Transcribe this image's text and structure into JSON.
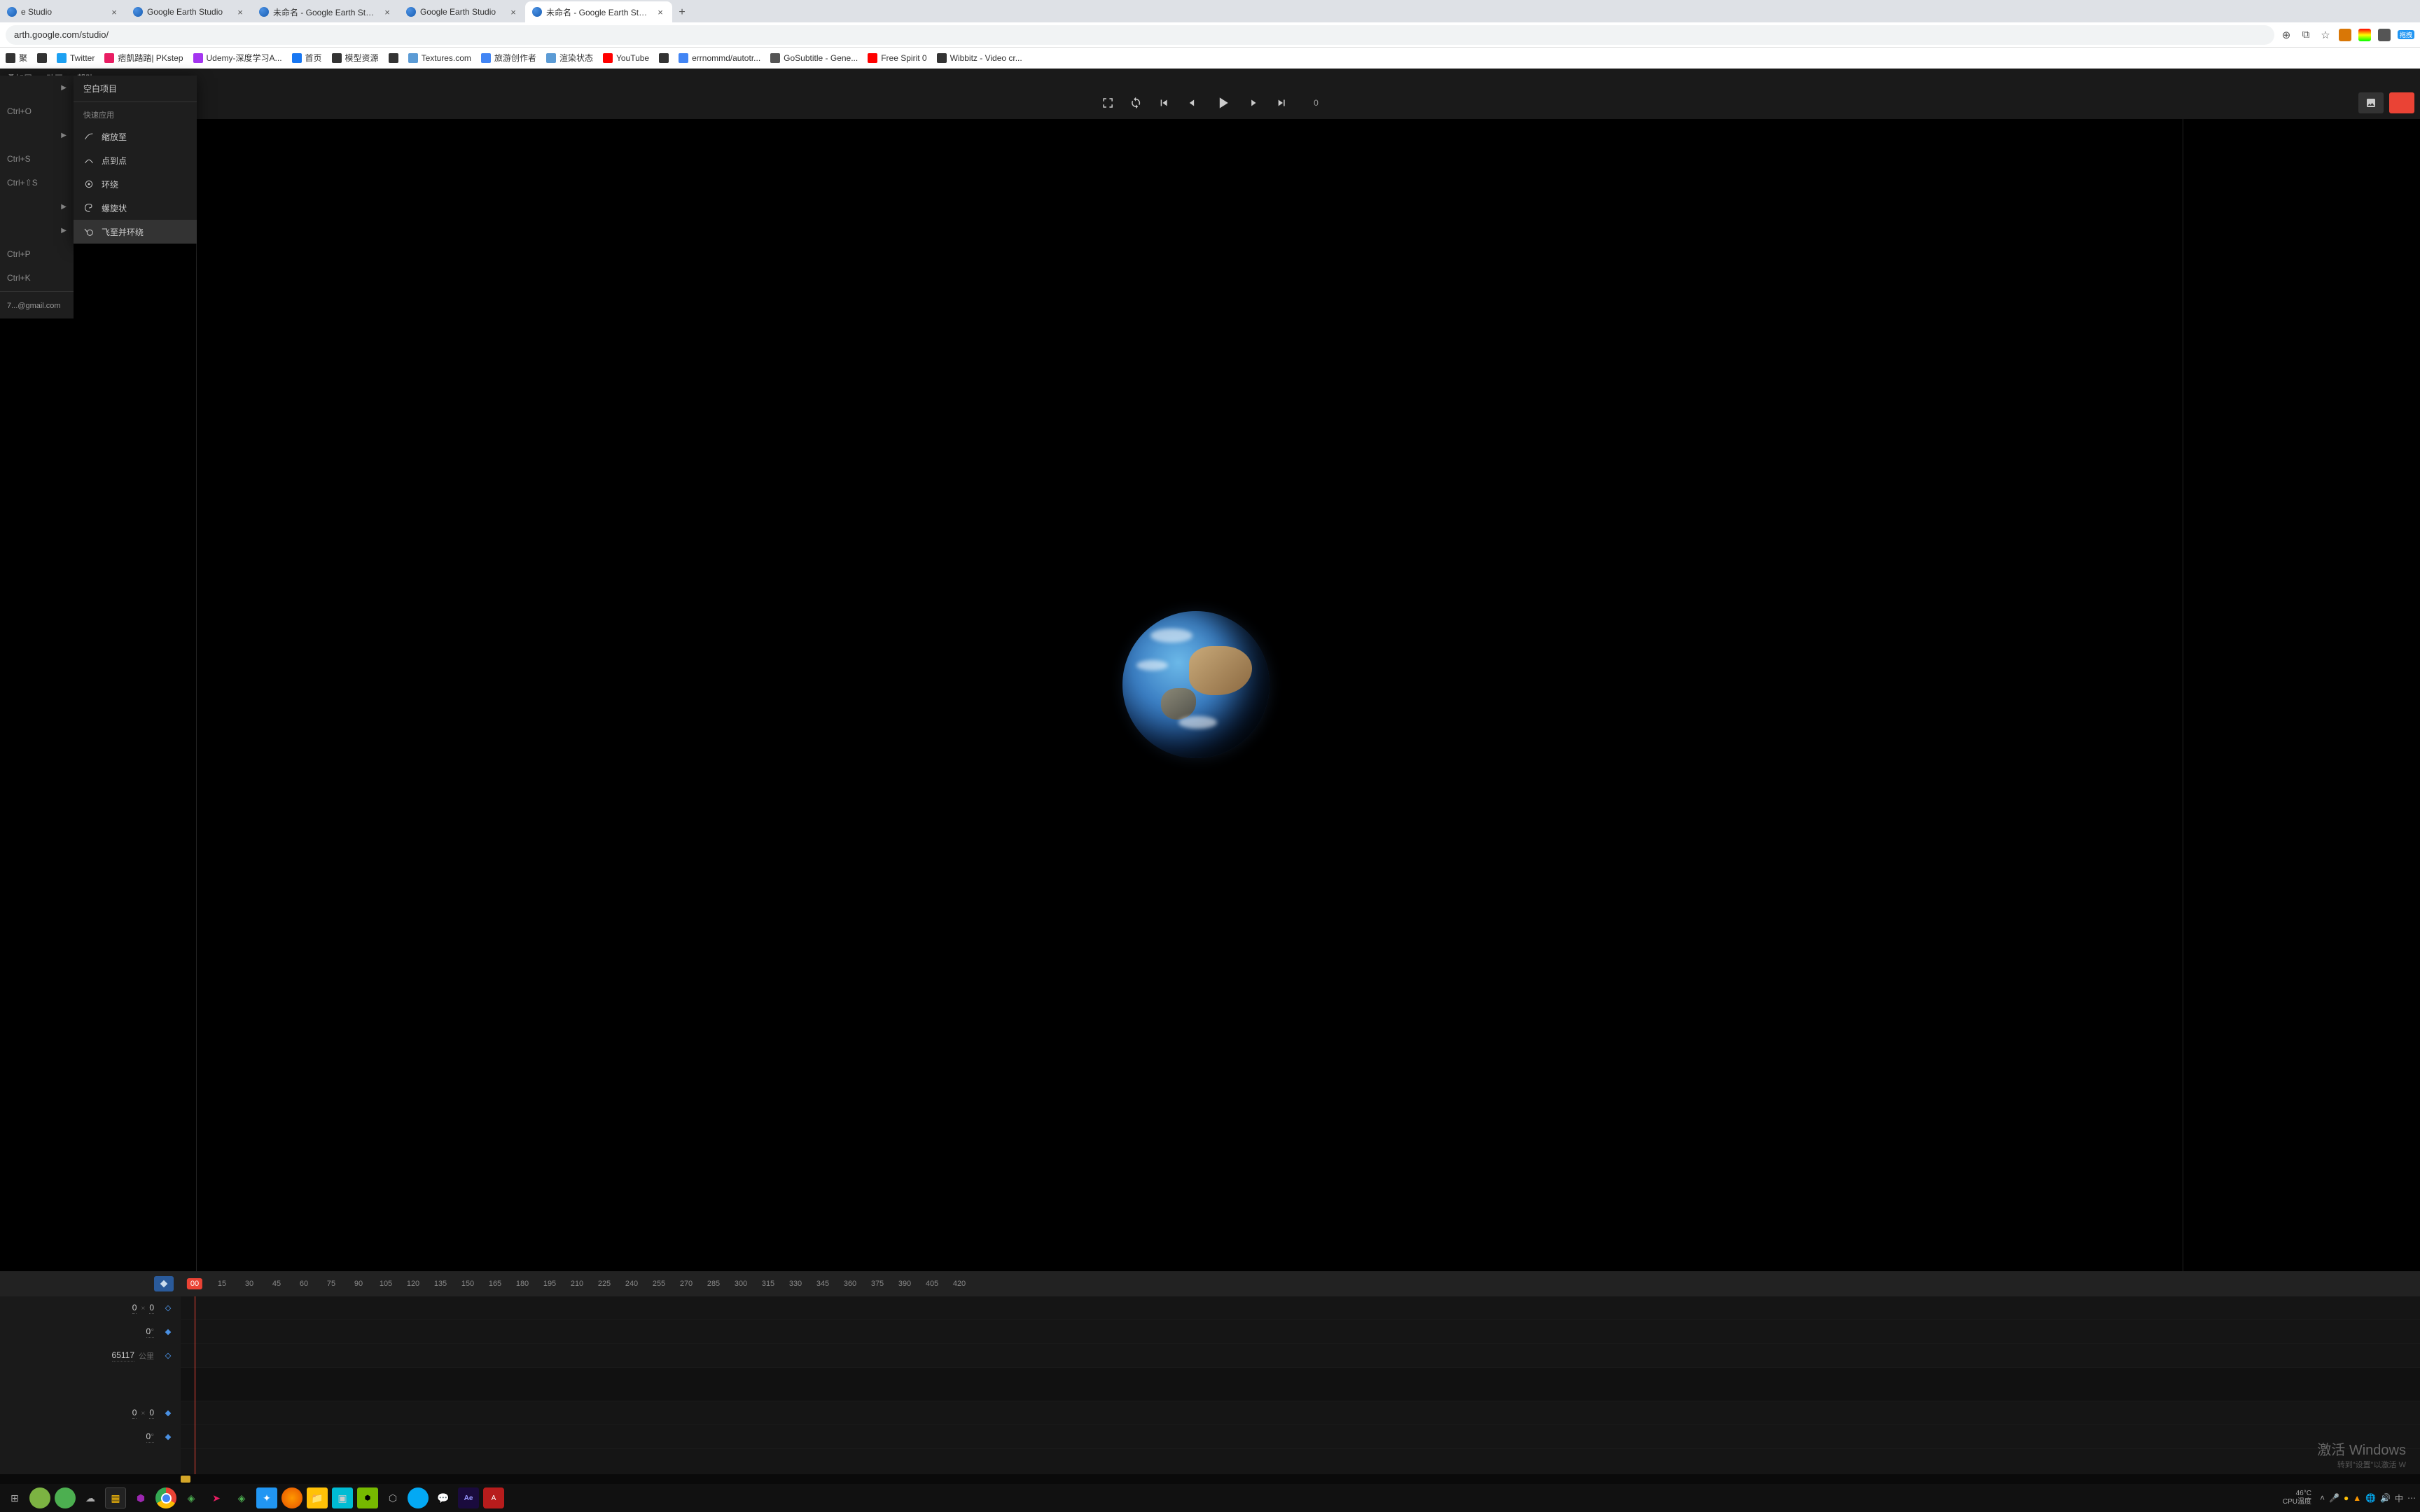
{
  "browser": {
    "tabs": [
      {
        "title": "e Studio",
        "active": false
      },
      {
        "title": "Google Earth Studio",
        "active": false
      },
      {
        "title": "未命名 - Google Earth Studio",
        "active": false
      },
      {
        "title": "Google Earth Studio",
        "active": false
      },
      {
        "title": "未命名 - Google Earth Studio",
        "active": true
      }
    ],
    "url": "arth.google.com/studio/",
    "bookmarks": [
      {
        "label": "聚",
        "color": "#333"
      },
      {
        "label": "",
        "color": "#333",
        "icon_only": true
      },
      {
        "label": "Twitter",
        "color": "#1da1f2"
      },
      {
        "label": "痞凱踏踏| PKstep",
        "color": "#e91e63"
      },
      {
        "label": "Udemy-深度学习A...",
        "color": "#a435f0"
      },
      {
        "label": "首页",
        "color": "#1877f2"
      },
      {
        "label": "模型资源",
        "color": "#333"
      },
      {
        "label": "",
        "color": "#333",
        "icon_only": true
      },
      {
        "label": "Textures.com",
        "color": "#5b9bd5"
      },
      {
        "label": "旅游创作者",
        "color": "#4285f4"
      },
      {
        "label": "渲染状态",
        "color": "#5b9bd5"
      },
      {
        "label": "YouTube",
        "color": "#ff0000"
      },
      {
        "label": "",
        "color": "#333",
        "icon_only": true
      },
      {
        "label": "errnommd/autotr...",
        "color": "#4285f4"
      },
      {
        "label": "GoSubtitle - Gene...",
        "color": "#555"
      },
      {
        "label": "Free Spirit 0",
        "color": "#ff0000"
      },
      {
        "label": "Wibbitz - Video cr...",
        "color": "#333"
      }
    ],
    "ext_button": "拖拽"
  },
  "menu": {
    "items": [
      "叠加层",
      "动画",
      "帮助"
    ]
  },
  "dropdown": {
    "rows": [
      {
        "shortcut": "",
        "arrow": true
      },
      {
        "shortcut": "Ctrl+O"
      },
      {
        "shortcut": "",
        "arrow": true
      },
      {
        "shortcut": "Ctrl+S"
      },
      {
        "shortcut": "Ctrl+⇧S"
      },
      {
        "shortcut": "",
        "arrow": true
      },
      {
        "shortcut": "",
        "arrow": true
      },
      {
        "shortcut": "Ctrl+P"
      },
      {
        "shortcut": "Ctrl+K"
      }
    ],
    "email": "7...@gmail.com"
  },
  "submenu": {
    "header": "空白项目",
    "section_label": "快速应用",
    "items": [
      "缩放至",
      "点到点",
      "环绕",
      "螺旋状",
      "飞至并环绕"
    ],
    "highlighted": 4
  },
  "toolbar": {
    "frame": "0"
  },
  "timeline": {
    "ticks": [
      "00",
      "15",
      "30",
      "45",
      "60",
      "75",
      "90",
      "105",
      "120",
      "135",
      "150",
      "165",
      "180",
      "195",
      "210",
      "225",
      "240",
      "255",
      "270",
      "285",
      "300",
      "315",
      "330",
      "345",
      "360",
      "375",
      "390",
      "405",
      "420"
    ],
    "current_tick": 0,
    "props": [
      {
        "v1": "0",
        "sep": "×",
        "v2": "0",
        "kf": false,
        "dark": false
      },
      {
        "v1": "0",
        "deg": true,
        "kf": true,
        "dark": false
      },
      {
        "v1": "65117",
        "unit": "公里",
        "kf": false,
        "dark": false
      },
      {
        "spacer": true,
        "dark": true
      },
      {
        "v1": "0",
        "sep": "×",
        "v2": "0",
        "kf": true,
        "dark": false
      },
      {
        "v1": "0",
        "deg": true,
        "kf": true,
        "dark": false
      }
    ]
  },
  "watermark": {
    "line1": "激活 Windows",
    "line2": "转到\"设置\"以激活 W"
  },
  "taskbar": {
    "temp_label": "46°C",
    "temp_sub": "CPU温度",
    "lang": "中"
  }
}
